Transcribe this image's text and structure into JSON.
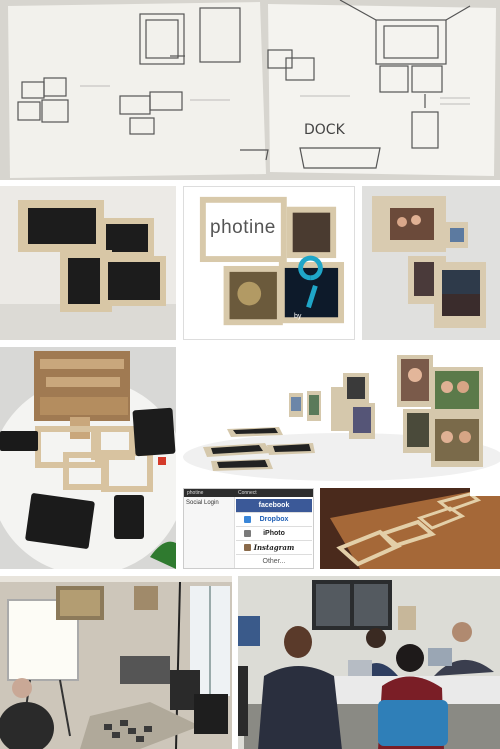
{
  "collage": {
    "photine_logo": {
      "wordmark": "photine",
      "by_label": "by"
    },
    "app_screen": {
      "header_title": "photine",
      "header_right": "Connect",
      "sidebar_title": "Social Login",
      "menu": [
        "facebook",
        "Dropbox",
        "iPhoto",
        "Instagram",
        "Other..."
      ]
    },
    "sketch_words": [
      "DOCK"
    ]
  }
}
